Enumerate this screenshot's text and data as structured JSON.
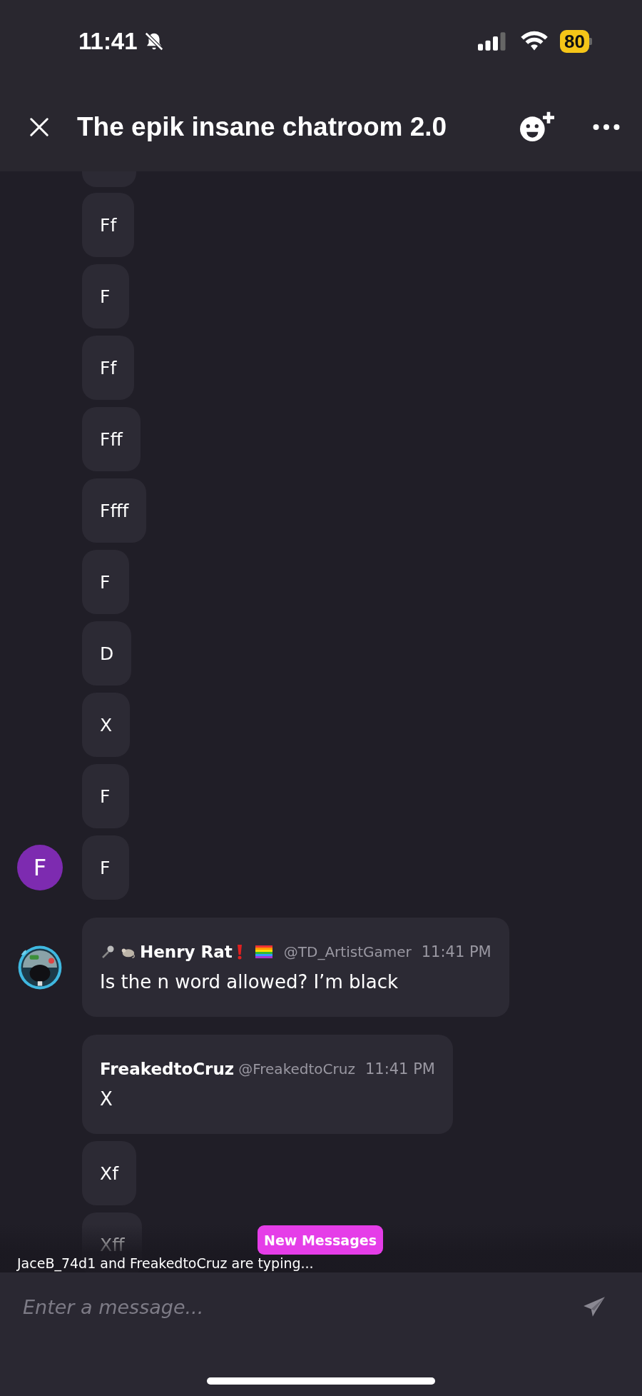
{
  "status_bar": {
    "time": "11:41",
    "silent": true,
    "battery": "80"
  },
  "header": {
    "title": "The epik insane chatroom 2.0"
  },
  "groups": [
    {
      "kind": "stack",
      "avatar": {
        "kind": "letter",
        "letter": "F",
        "color": "#7d2bb0"
      },
      "messages": [
        "Ff",
        "F",
        "Ff",
        "Fff",
        "Ffff",
        "F",
        "D",
        "X",
        "F",
        "F"
      ]
    },
    {
      "kind": "post",
      "author": "Henry Rat",
      "badges": true,
      "handle": "@TD_ArtistGamer",
      "time": "11:41 PM",
      "messages": [
        "Is the n word allowed? I’m black"
      ]
    },
    {
      "kind": "post",
      "author": "FreakedtoCruz",
      "badges": false,
      "handle": "@FreakedtoCruz",
      "time": "11:41 PM",
      "messages": [
        "X",
        "Xf",
        "Xff"
      ]
    }
  ],
  "new_messages": "New Messages",
  "typing": "JaceB_74d1 and FreakedtoCruz are typing...",
  "composer": {
    "placeholder": "Enter a message..."
  }
}
